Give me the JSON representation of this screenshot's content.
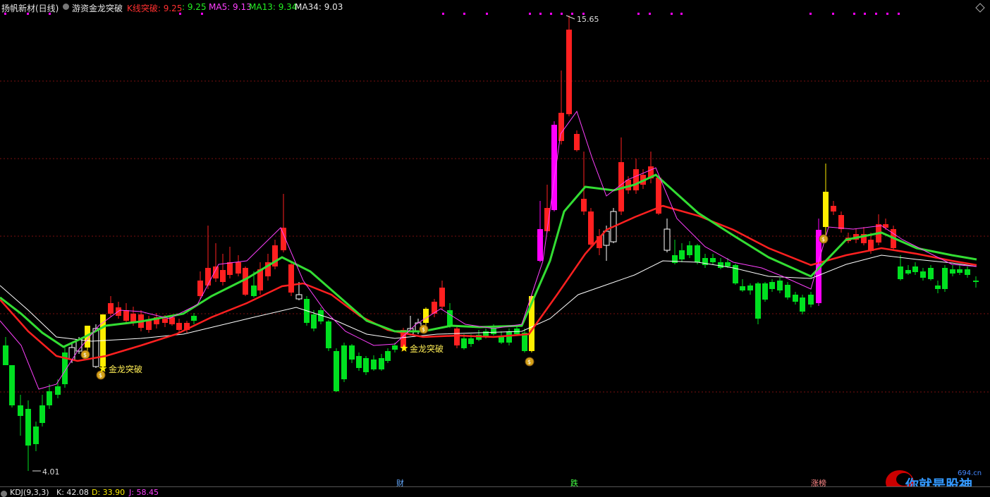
{
  "header": {
    "stock_name": "扬帆新材(日线)",
    "indicator_name": "游资金龙突破",
    "kline_break_label": "K线突破: 9.25",
    "kline_break_value": ": 9.25",
    "ma5": "MA5: 9.13",
    "ma13": "MA13: 9.34",
    "ma34": "MA34: 9.03",
    "corner_icon": "diamond-icon"
  },
  "annotations": {
    "high_price": "15.65",
    "low_price": "4.01",
    "signal_label": "金龙突破",
    "event_tags": [
      "财",
      "跌",
      "涨榜"
    ]
  },
  "bottom": {
    "kdj_name": "KDJ(9,3,3)",
    "k": "K: 42.08",
    "d": "D: 33.90",
    "j": "J: 58.45"
  },
  "watermark": {
    "site": "694.cn",
    "text": "你就是股神"
  },
  "colors": {
    "up": "#ff2020",
    "down": "#00e020",
    "ma5": "#ff40ff",
    "ma13": "#33dd33",
    "ma34": "#ffffff",
    "ma_mid": "#ff2020",
    "signal_yellow": "#ffee00",
    "signal_magenta": "#ff00ff",
    "grid": "#7a1010"
  },
  "chart_data": {
    "type": "candlestick",
    "price_high": 15.65,
    "price_low": 4.01
  }
}
